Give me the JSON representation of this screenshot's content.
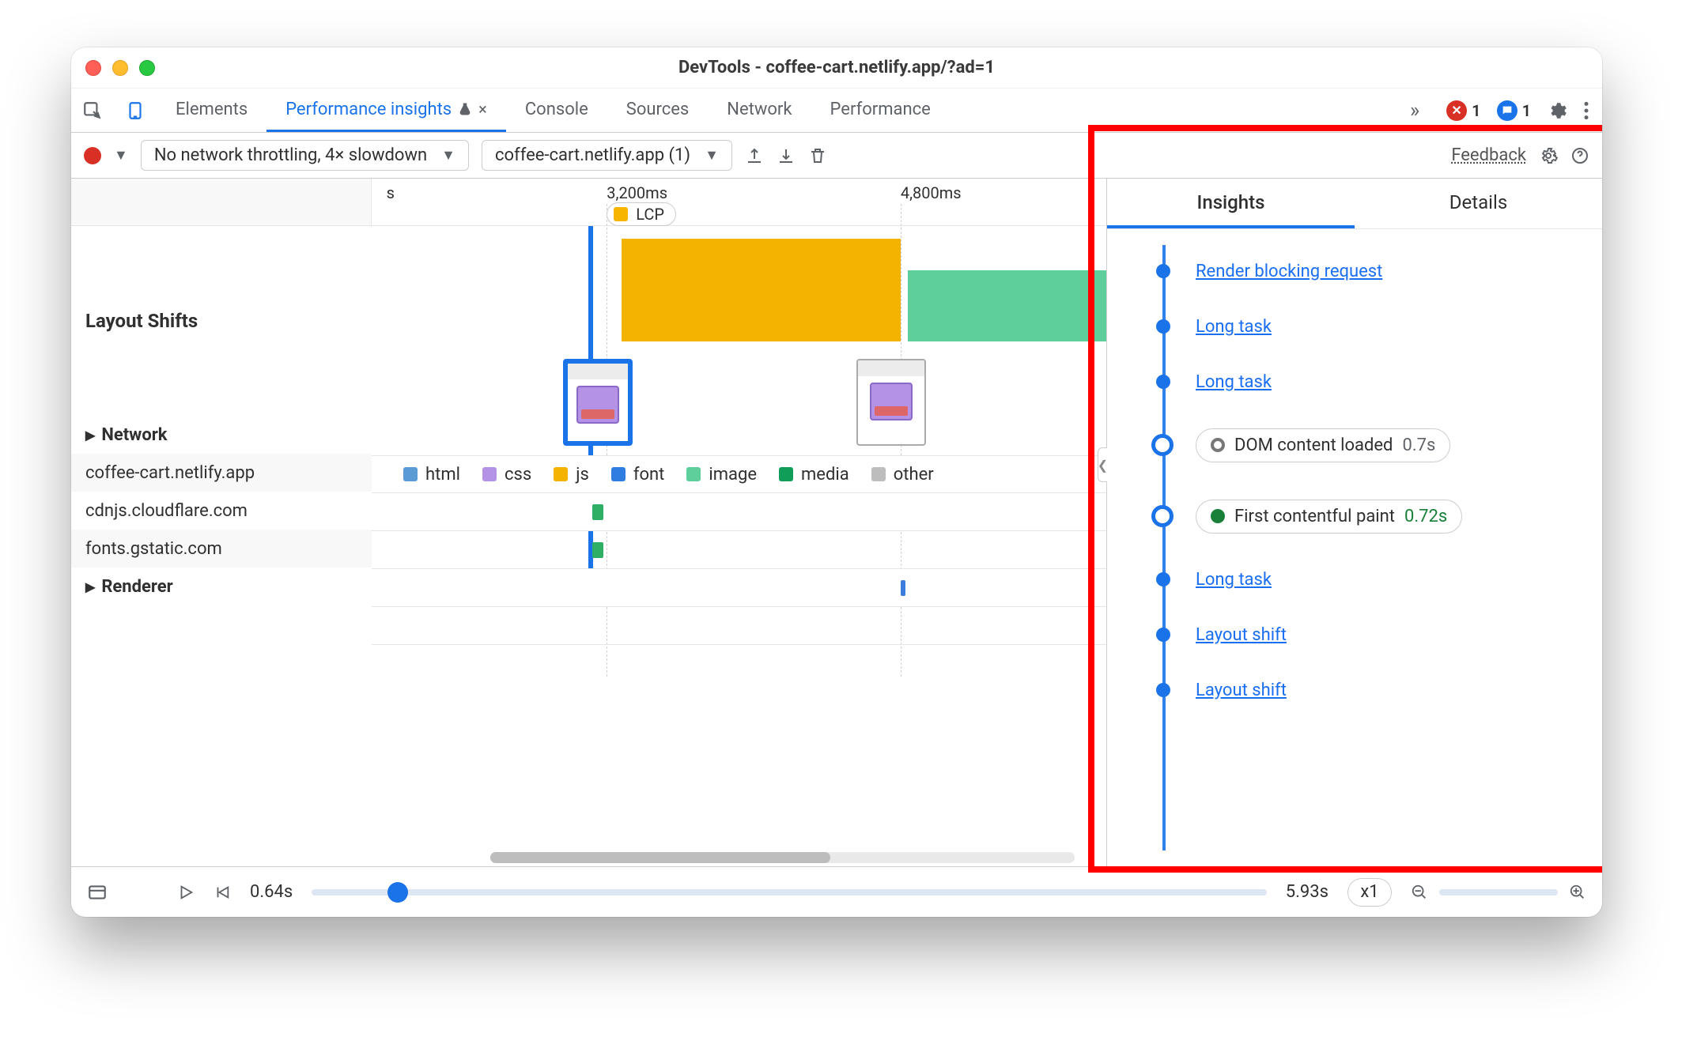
{
  "window": {
    "title": "DevTools - coffee-cart.netlify.app/?ad=1"
  },
  "devtools_tabs": {
    "items": [
      "Elements",
      "Performance insights",
      "Console",
      "Sources",
      "Network",
      "Performance"
    ],
    "active_index": 1,
    "experiment_on_active": true,
    "overflow_glyph": "»"
  },
  "counters": {
    "errors": "1",
    "issues": "1"
  },
  "panel_toolbar": {
    "throttling_label": "No network throttling, 4× slowdown",
    "origin_label": "coffee-cart.netlify.app (1)",
    "feedback_label": "Feedback"
  },
  "ruler": {
    "ticks": [
      {
        "label": "s",
        "left_pct": 2
      },
      {
        "label": "3,200ms",
        "left_pct": 32
      },
      {
        "label": "4,800ms",
        "left_pct": 72
      }
    ],
    "lcp_label": "LCP"
  },
  "timeline_sections": {
    "layout_shifts": "Layout Shifts",
    "network": "Network",
    "renderer": "Renderer",
    "origins": [
      "coffee-cart.netlify.app",
      "cdnjs.cloudflare.com",
      "fonts.gstatic.com"
    ]
  },
  "legend": {
    "items": [
      {
        "label": "html",
        "color": "#5b9bd5"
      },
      {
        "label": "css",
        "color": "#b493e6"
      },
      {
        "label": "js",
        "color": "#f5b301"
      },
      {
        "label": "font",
        "color": "#2f7de1"
      },
      {
        "label": "image",
        "color": "#5ecf9b"
      },
      {
        "label": "media",
        "color": "#0f9d58"
      },
      {
        "label": "other",
        "color": "#bdbdbd"
      }
    ]
  },
  "sidebar": {
    "tabs": {
      "insights": "Insights",
      "details": "Details",
      "active": "insights"
    },
    "items": [
      {
        "type": "link",
        "label": "Render blocking request"
      },
      {
        "type": "link",
        "label": "Long task"
      },
      {
        "type": "link",
        "label": "Long task"
      },
      {
        "type": "event",
        "dot": "gray",
        "label": "DOM content loaded",
        "value": "0.7s",
        "value_color": "dim"
      },
      {
        "type": "event",
        "dot": "green",
        "label": "First contentful paint",
        "value": "0.72s",
        "value_color": "green"
      },
      {
        "type": "link",
        "label": "Long task"
      },
      {
        "type": "link",
        "label": "Layout shift"
      },
      {
        "type": "link",
        "label": "Layout shift"
      }
    ]
  },
  "playbar": {
    "start_label": "0.64s",
    "end_label": "5.93s",
    "speed_label": "x1",
    "slider_pct": 9,
    "zoom_pct": 12
  },
  "colors": {
    "blue": "#1a73e8",
    "link": "#1a6ef2",
    "green": "#188038",
    "orange": "#f5b301",
    "red": "#d93025"
  }
}
